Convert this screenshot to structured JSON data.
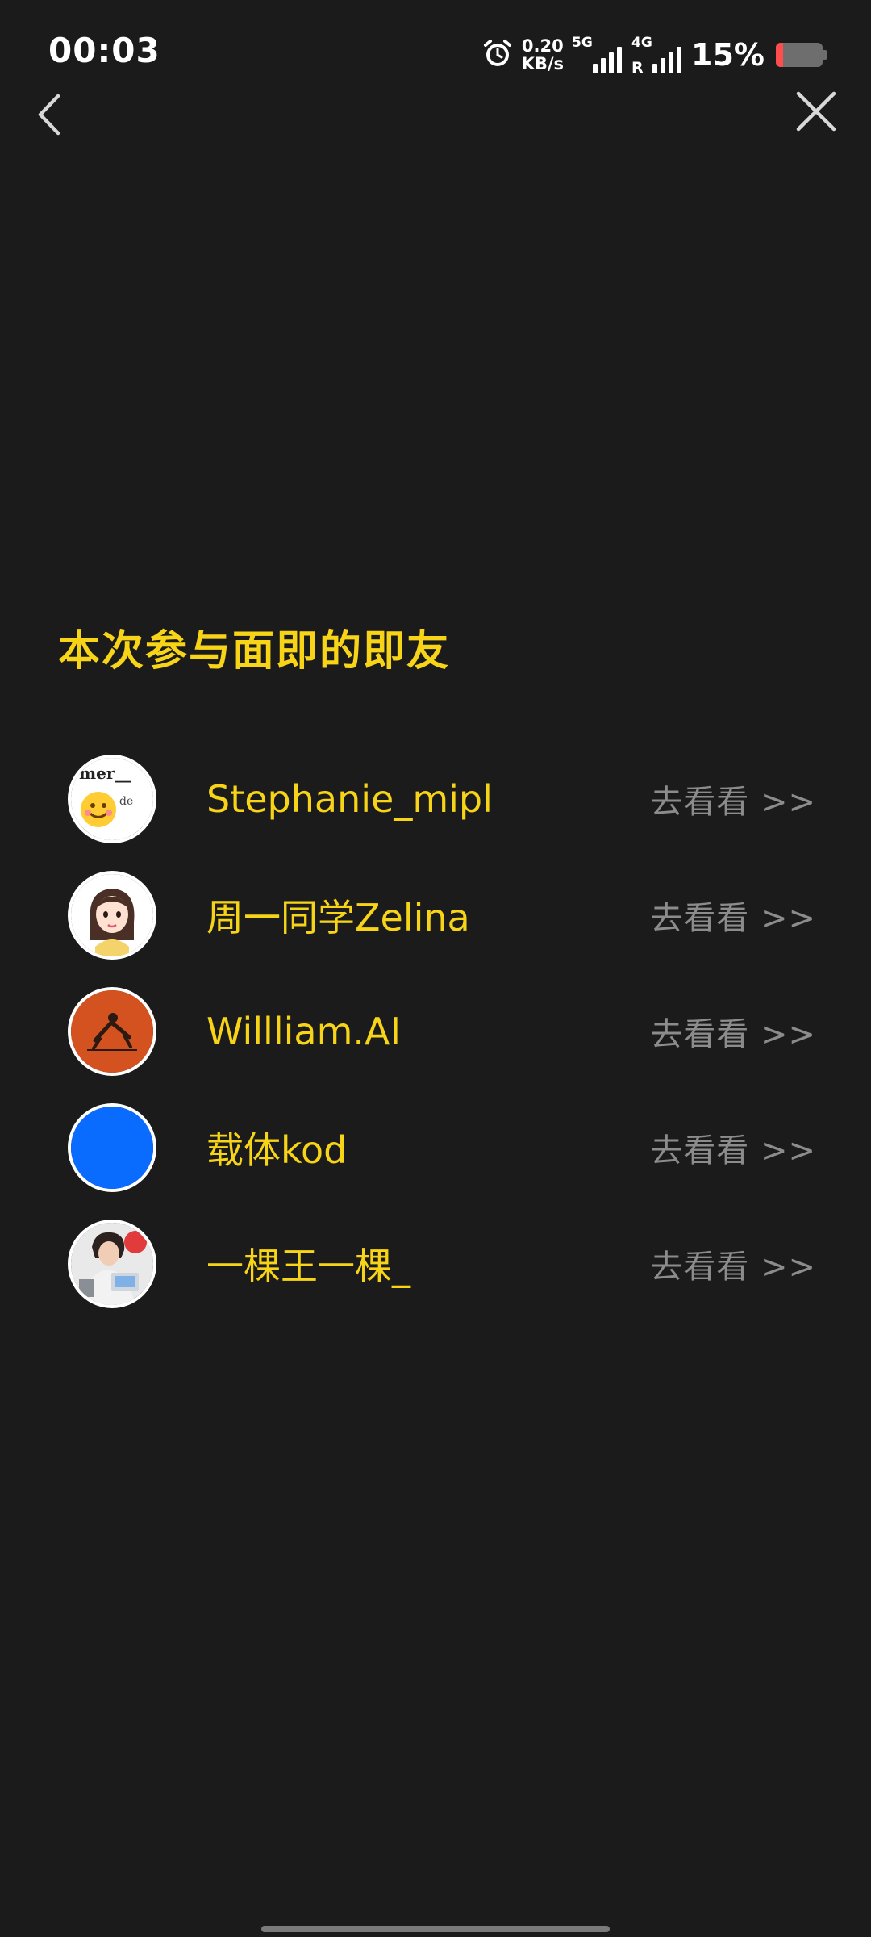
{
  "status_bar": {
    "time": "00:03",
    "net_speed_value": "0.20",
    "net_speed_unit": "KB/s",
    "sim1_tag": "5G",
    "sim2_tag": "4G",
    "sim2_roaming": "R",
    "battery_percent_text": "15%",
    "battery_level": 0.15,
    "icons": [
      "alarm-icon",
      "signal-5g-icon",
      "signal-4g-icon",
      "battery-icon"
    ]
  },
  "nav": {
    "back_icon": "chevron-left-icon",
    "close_icon": "close-icon"
  },
  "section": {
    "title": "本次参与面即的即友"
  },
  "friends": [
    {
      "name": "Stephanie_mipl",
      "action": "去看看 >>",
      "avatar": "avatar-emoji-text"
    },
    {
      "name": "周一同学Zelina",
      "action": "去看看 >>",
      "avatar": "avatar-cartoon-girl"
    },
    {
      "name": "Willliam.AI",
      "action": "去看看 >>",
      "avatar": "avatar-climber-orange"
    },
    {
      "name": "载体kod",
      "action": "去看看 >>",
      "avatar": "avatar-blue-solid"
    },
    {
      "name": "一棵王一棵_",
      "action": "去看看 >>",
      "avatar": "avatar-photo-person"
    }
  ],
  "colors": {
    "background": "#1b1b1b",
    "accent_yellow": "#f7d417",
    "link_gray": "#8c8c8c",
    "battery_low": "#ff4d4d"
  }
}
